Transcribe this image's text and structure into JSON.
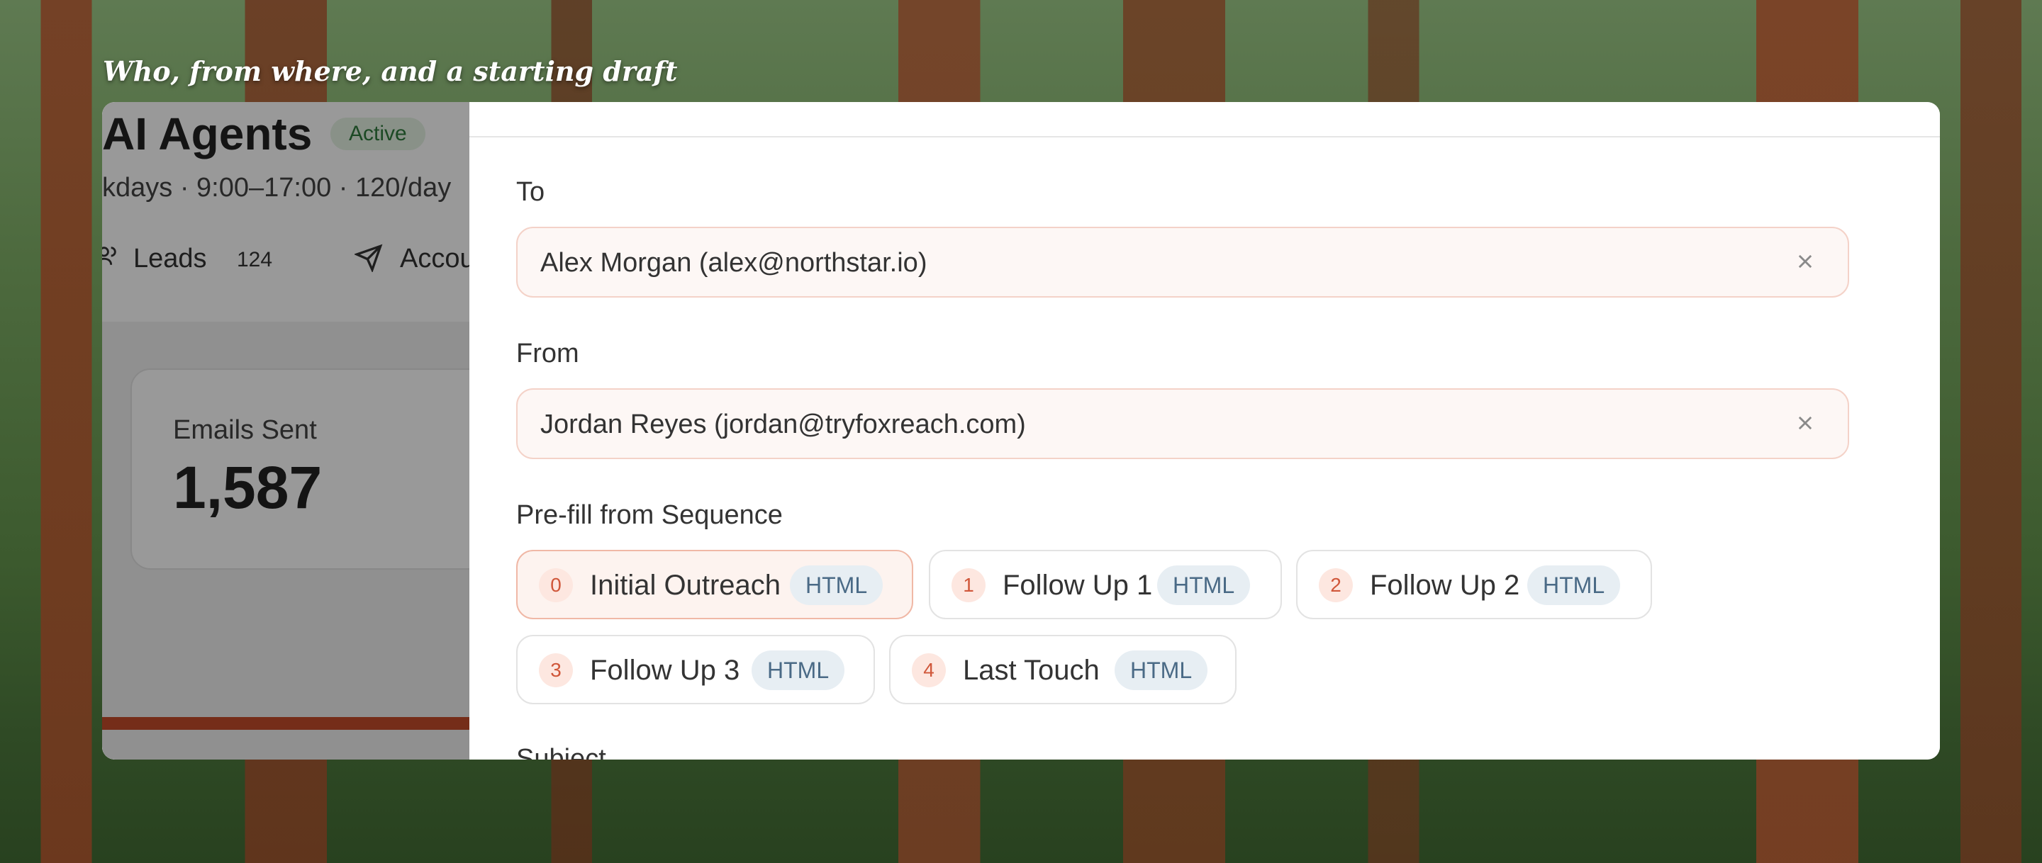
{
  "caption": "Who, from where, and a starting draft",
  "background_app": {
    "title": "AI Agents",
    "status_badge": "Active",
    "schedule": "kdays · 9:00–17:00 · 120/day",
    "tabs": [
      {
        "label": "Leads",
        "count": "124"
      },
      {
        "label": "Accou"
      }
    ],
    "stat": {
      "label": "Emails Sent",
      "value": "1,587"
    }
  },
  "modal": {
    "to": {
      "label": "To",
      "value": "Alex Morgan (alex@northstar.io)"
    },
    "from": {
      "label": "From",
      "value": "Jordan Reyes (jordan@tryfoxreach.com)"
    },
    "prefill": {
      "label": "Pre-fill from Sequence",
      "steps": [
        {
          "num": "0",
          "name": "Initial Outreach",
          "tag": "HTML"
        },
        {
          "num": "1",
          "name": "Follow Up 1",
          "tag": "HTML"
        },
        {
          "num": "2",
          "name": "Follow Up 2",
          "tag": "HTML"
        },
        {
          "num": "3",
          "name": "Follow Up 3",
          "tag": "HTML"
        },
        {
          "num": "4",
          "name": "Last Touch",
          "tag": "HTML"
        }
      ]
    },
    "subject_label": "Subject",
    "icons": {
      "clear": "close-icon",
      "leads": "users-icon",
      "accounts": "send-icon"
    }
  }
}
